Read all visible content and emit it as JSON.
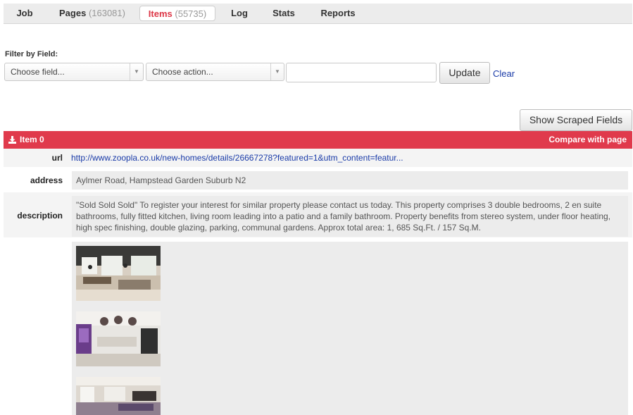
{
  "tabs": [
    {
      "label": "Job",
      "count": ""
    },
    {
      "label": "Pages",
      "count": "(163081)"
    },
    {
      "label": "Items",
      "count": "(55735)"
    },
    {
      "label": "Log",
      "count": ""
    },
    {
      "label": "Stats",
      "count": ""
    },
    {
      "label": "Reports",
      "count": ""
    }
  ],
  "filter": {
    "label": "Filter by Field:",
    "field_select": "Choose field...",
    "action_select": "Choose action...",
    "value": "",
    "update_label": "Update",
    "clear_label": "Clear"
  },
  "show_scraped_label": "Show Scraped Fields",
  "item": {
    "title": "Item 0",
    "compare_label": "Compare with page",
    "fields": {
      "url_label": "url",
      "url_value": "http://www.zoopla.co.uk/new-homes/details/26667278?featured=1&utm_content=featur...",
      "address_label": "address",
      "address_value": "Aylmer Road, Hampstead Garden Suburb N2",
      "description_label": "description",
      "description_value": "\"Sold Sold Sold\" To register your interest for similar property please contact us today. This property comprises 3 double bedrooms, 2 en suite bathrooms, fully fitted kitchen, living room leading into a patio and a family bathroom. Property benefits from stereo system, under floor heating, high spec finishing, double glazing, parking, communal gardens. Approx total area: 1, 685 Sq.Ft. / 157 Sq.M."
    }
  },
  "colors": {
    "accent": "#e03a4c",
    "link": "#1a3ba8"
  },
  "icons": {
    "item": "download-icon",
    "select": "caret-down-icon"
  }
}
